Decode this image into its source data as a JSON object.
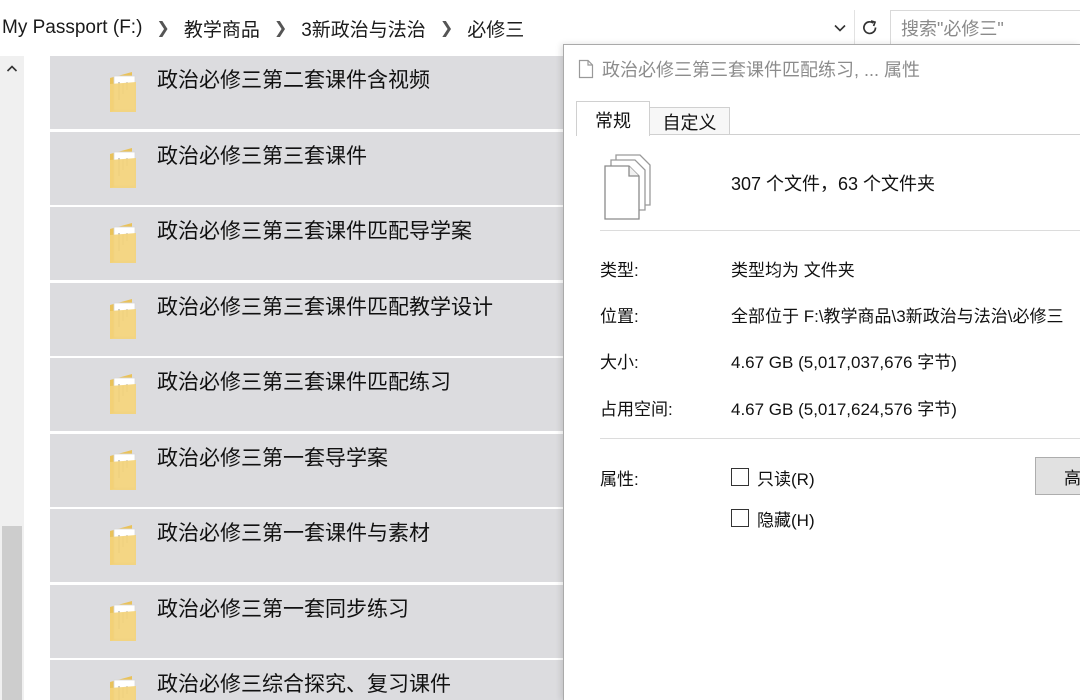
{
  "address_bar": {
    "crumbs": [
      "My Passport (F:)",
      "教学商品",
      "3新政治与法治",
      "必修三"
    ],
    "search_placeholder": "搜索\"必修三\""
  },
  "file_list": {
    "items": [
      {
        "name": "政治必修三第二套课件含视频",
        "icon": "folder-icon"
      },
      {
        "name": "政治必修三第三套课件",
        "icon": "folder-icon"
      },
      {
        "name": "政治必修三第三套课件匹配导学案",
        "icon": "folder-icon"
      },
      {
        "name": "政治必修三第三套课件匹配教学设计",
        "icon": "folder-icon"
      },
      {
        "name": "政治必修三第三套课件匹配练习",
        "icon": "folder-icon"
      },
      {
        "name": "政治必修三第一套导学案",
        "icon": "folder-icon"
      },
      {
        "name": "政治必修三第一套课件与素材",
        "icon": "folder-icon"
      },
      {
        "name": "政治必修三第一套同步练习",
        "icon": "folder-icon"
      },
      {
        "name": "政治必修三综合探究、复习课件",
        "icon": "folder-icon"
      }
    ]
  },
  "dialog": {
    "title": "政治必修三第三套课件匹配练习, ... 属性",
    "tabs": [
      "常规",
      "自定义"
    ],
    "summary": "307 个文件，63 个文件夹",
    "type_label": "类型:",
    "type_value": "类型均为 文件夹",
    "location_label": "位置:",
    "location_value": "全部位于 F:\\教学商品\\3新政治与法治\\必修三",
    "size_label": "大小:",
    "size_value": "4.67 GB (5,017,037,676 字节)",
    "disk_label": "占用空间:",
    "disk_value": "4.67 GB (5,017,624,576 字节)",
    "attr_label": "属性:",
    "readonly_label": "只读(R)",
    "hidden_label": "隐藏(H)",
    "advanced_label": "高"
  },
  "colors": {
    "row_selected": "#dcdcdf",
    "folder_yellow": "#f3d37a"
  }
}
